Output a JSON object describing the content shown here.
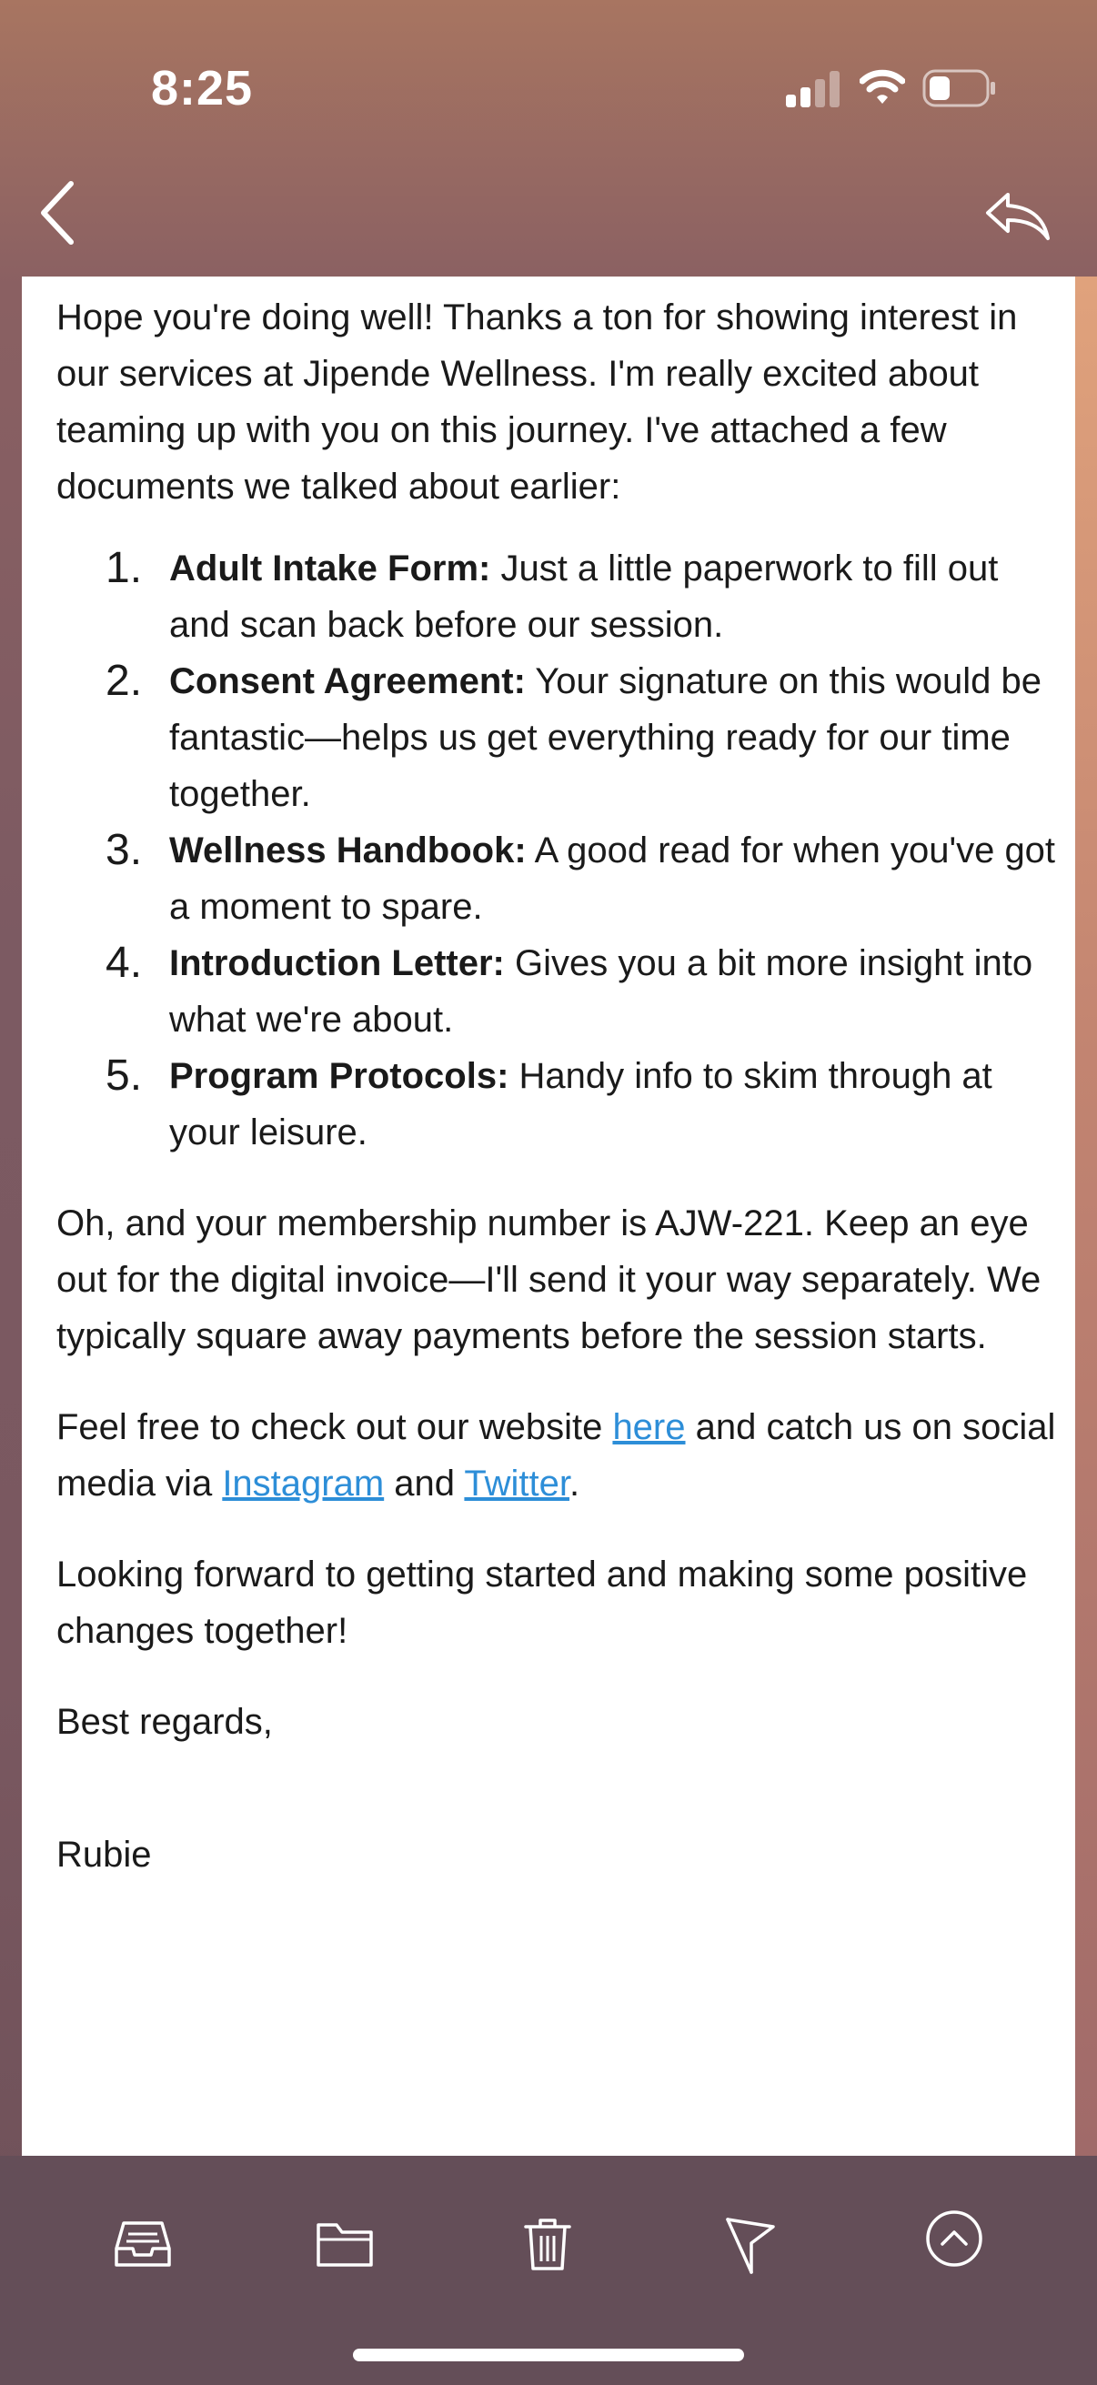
{
  "status": {
    "time": "8:25"
  },
  "email": {
    "intro": "Hope you're doing well! Thanks a ton for showing interest in our services at Jipende Wellness. I'm really excited about teaming up with you on this journey. I've attached a few documents we talked about earlier:",
    "attachments": [
      {
        "num": "1.",
        "title": "Adult Intake Form:",
        "desc": " Just a little paperwork to fill out and scan back before our session."
      },
      {
        "num": "2.",
        "title": "Consent Agreement:",
        "desc": " Your signature on this would be fantastic—helps us get everything ready for our time together."
      },
      {
        "num": "3.",
        "title": "Wellness Handbook:",
        "desc": " A good read for when you've got a moment to spare."
      },
      {
        "num": "4.",
        "title": "Introduction Letter:",
        "desc": " Gives you a bit more insight into what we're about."
      },
      {
        "num": "5.",
        "title": "Program Protocols:",
        "desc": " Handy info to skim through at your leisure."
      }
    ],
    "membership": "Oh, and your membership number is AJW-221. Keep an eye out for the digital invoice—I'll send it your way separately. We typically square away payments before the session starts.",
    "website": {
      "before": "Feel free to check out our website ",
      "here_link": "here",
      "middle": " and catch us on social media via ",
      "instagram_link": "Instagram",
      "and": " and ",
      "twitter_link": "Twitter",
      "end": "."
    },
    "closing": "Looking forward to getting started and making some positive changes together!",
    "signoff": "Best regards,",
    "signature": "Rubie"
  },
  "icons": {
    "nav": [
      "back-chevron-icon",
      "reply-icon"
    ],
    "toolbar": [
      "inbox-tray-icon",
      "folder-icon",
      "trash-icon",
      "flag-icon",
      "chevron-up-circle-icon"
    ],
    "status": [
      "cellular-signal-icon",
      "wifi-icon",
      "battery-icon"
    ]
  },
  "colors": {
    "link": "#2d8ed8",
    "toolbar": "#644e58"
  }
}
